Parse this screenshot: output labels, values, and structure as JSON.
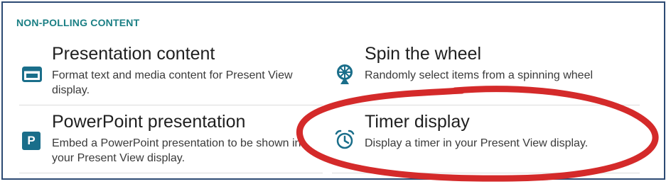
{
  "section": {
    "title": "NON-POLLING CONTENT"
  },
  "items": [
    {
      "title": "Presentation content",
      "description": "Format text and media content for Present View display.",
      "icon": "presentation-content-icon"
    },
    {
      "title": "Spin the wheel",
      "description": "Randomly select items from a spinning wheel",
      "icon": "wheel-icon"
    },
    {
      "title": "PowerPoint presentation",
      "description": "Embed a PowerPoint presentation to be shown in your Present View display.",
      "icon": "powerpoint-icon",
      "icon_letter": "P"
    },
    {
      "title": "Timer display",
      "description": "Display a timer in your Present View display.",
      "icon": "alarm-clock-icon"
    }
  ],
  "colors": {
    "accent": "#1a7f84",
    "icon": "#1a6e8a",
    "annotation": "#d42a2a",
    "frame": "#2c4a73"
  }
}
